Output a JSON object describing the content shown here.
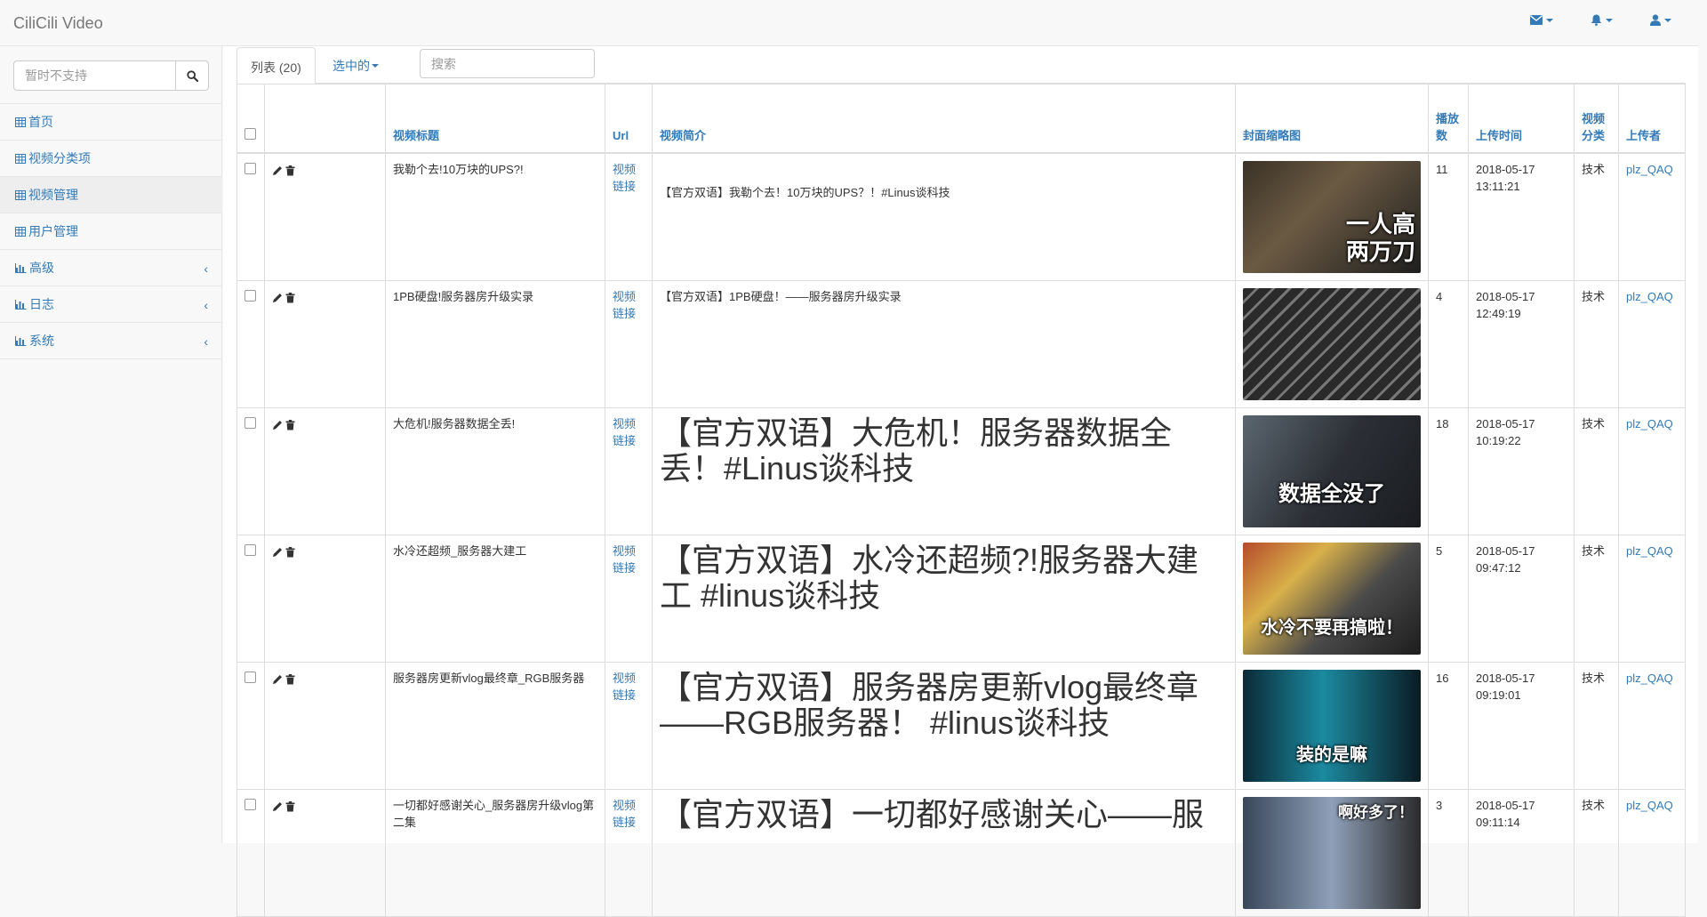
{
  "app": {
    "brand": "CiliCili Video"
  },
  "nav_icons": [
    "envelope-icon",
    "bell-icon",
    "user-icon"
  ],
  "sidebar": {
    "search_placeholder": "暂时不支持",
    "items": [
      {
        "label": "首页",
        "icon": "table-icon",
        "expandable": false,
        "active": false
      },
      {
        "label": "视频分类项",
        "icon": "table-icon",
        "expandable": false,
        "active": false
      },
      {
        "label": "视频管理",
        "icon": "table-icon",
        "expandable": false,
        "active": true
      },
      {
        "label": "用户管理",
        "icon": "table-icon",
        "expandable": false,
        "active": false
      },
      {
        "label": "高级",
        "icon": "bar-chart-icon",
        "expandable": true,
        "active": false
      },
      {
        "label": "日志",
        "icon": "bar-chart-icon",
        "expandable": true,
        "active": false
      },
      {
        "label": "系统",
        "icon": "bar-chart-icon",
        "expandable": true,
        "active": false
      }
    ]
  },
  "toolbar": {
    "tab_list": "列表 (20)",
    "tab_selected": "选中的",
    "search_placeholder": "搜索"
  },
  "table": {
    "headers": {
      "title": "视频标题",
      "url": "Url",
      "desc": "视频简介",
      "thumb": "封面缩略图",
      "plays": "播放数",
      "time": "上传时间",
      "category": "视频分类",
      "uploader": "上传者"
    },
    "rows": [
      {
        "title": "我勒个去!10万块的UPS?!",
        "url": "视频链接",
        "desc": "【官方双语】我勒个去！10万块的UPS？！#Linus谈科技",
        "desc_large": false,
        "thumb_caption": "一人高\n两万刀",
        "plays": "11",
        "date": "2018-05-17",
        "time": "13:11:21",
        "category": "技术",
        "uploader": "plz_QAQ"
      },
      {
        "title": "1PB硬盘!服务器房升级实录",
        "url": "视频链接",
        "desc": "【官方双语】1PB硬盘！——服务器房升级实录",
        "desc_large": false,
        "thumb_caption": "",
        "plays": "4",
        "date": "2018-05-17",
        "time": "12:49:19",
        "category": "技术",
        "uploader": "plz_QAQ"
      },
      {
        "title": "大危机!服务器数据全丢!",
        "url": "视频链接",
        "desc": "【官方双语】大危机！服务器数据全丢！#Linus谈科技",
        "desc_large": true,
        "thumb_caption": "数据全没了",
        "plays": "18",
        "date": "2018-05-17",
        "time": "10:19:22",
        "category": "技术",
        "uploader": "plz_QAQ"
      },
      {
        "title": "水冷还超频_服务器大建工",
        "url": "视频链接",
        "desc": "【官方双语】水冷还超频?!服务器大建工 #linus谈科技",
        "desc_large": true,
        "thumb_caption": "水冷不要再搞啦！",
        "plays": "5",
        "date": "2018-05-17",
        "time": "09:47:12",
        "category": "技术",
        "uploader": "plz_QAQ"
      },
      {
        "title": "服务器房更新vlog最终章_RGB服务器",
        "url": "视频链接",
        "desc": "【官方双语】服务器房更新vlog最终章——RGB服务器！ #linus谈科技",
        "desc_large": true,
        "thumb_caption": "装的是嘛",
        "plays": "16",
        "date": "2018-05-17",
        "time": "09:19:01",
        "category": "技术",
        "uploader": "plz_QAQ"
      },
      {
        "title": "一切都好感谢关心_服务器房升级vlog第二集",
        "url": "视频链接",
        "desc": "【官方双语】一切都好感谢关心——服",
        "desc_large": true,
        "thumb_caption": "啊好多了！",
        "plays": "3",
        "date": "2018-05-17",
        "time": "09:11:14",
        "category": "技术",
        "uploader": "plz_QAQ"
      }
    ]
  }
}
